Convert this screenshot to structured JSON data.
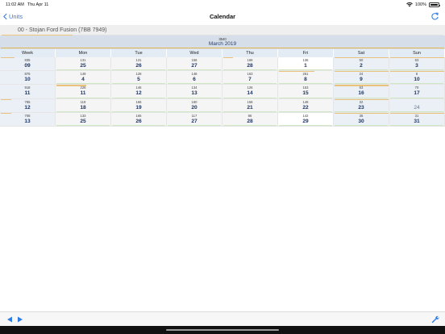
{
  "status_bar": {
    "time": "11:02 AM",
    "date": "Thu Apr 11",
    "battery": "100%",
    "battery_level": 1.0
  },
  "nav": {
    "back_label": "Units",
    "title": "Calendar"
  },
  "unit": {
    "name": "00 - Stojan Ford Fusion (7BB 7949)",
    "progress": 0.16
  },
  "month": {
    "count": "3540",
    "name": "March 2019",
    "progress": 1.0
  },
  "headers": [
    "Week",
    "Mon",
    "Tue",
    "Wed",
    "Thu",
    "Fri",
    "Sat",
    "Sun"
  ],
  "weeks": [
    {
      "count": "835",
      "week": "09",
      "bar": 0.25,
      "days": [
        {
          "count": "131",
          "date": "25",
          "bar": 0
        },
        {
          "count": "131",
          "date": "26",
          "bar": 0
        },
        {
          "count": "156",
          "date": "27",
          "bar": 0
        },
        {
          "count": "166",
          "date": "28",
          "bar": 0.18
        },
        {
          "count": "136",
          "date": "1",
          "bar": 0,
          "today": true
        },
        {
          "count": "50",
          "date": "2",
          "bar": 1.0,
          "weekend": true
        },
        {
          "count": "63",
          "date": "3",
          "bar": 1.0,
          "weekend": true
        }
      ]
    },
    {
      "count": "876",
      "week": "10",
      "bar": 0,
      "days": [
        {
          "count": "149",
          "date": "4",
          "bar": 0
        },
        {
          "count": "128",
          "date": "5",
          "bar": 0
        },
        {
          "count": "148",
          "date": "6",
          "bar": 0
        },
        {
          "count": "163",
          "date": "7",
          "bar": 0
        },
        {
          "count": "261",
          "date": "8",
          "bar": 0.65
        },
        {
          "count": "24",
          "date": "9",
          "bar": 1.0,
          "weekend": true
        },
        {
          "count": "6",
          "date": "10",
          "bar": 1.0,
          "weekend": true
        }
      ]
    },
    {
      "count": "918",
      "week": "11",
      "bar": 0,
      "days": [
        {
          "count": "226",
          "date": "11",
          "bar": 0.55
        },
        {
          "count": "146",
          "date": "12",
          "bar": 0
        },
        {
          "count": "134",
          "date": "13",
          "bar": 0
        },
        {
          "count": "126",
          "date": "14",
          "bar": 0
        },
        {
          "count": "153",
          "date": "15",
          "bar": 0
        },
        {
          "count": "63",
          "date": "16",
          "bar": 1.0,
          "weekend": true
        },
        {
          "count": "70",
          "date": "17",
          "bar": 0,
          "weekend": true
        }
      ]
    },
    {
      "count": "785",
      "week": "12",
      "bar": 0.2,
      "days": [
        {
          "count": "119",
          "date": "18",
          "bar": 0
        },
        {
          "count": "166",
          "date": "19",
          "bar": 0
        },
        {
          "count": "160",
          "date": "20",
          "bar": 0
        },
        {
          "count": "158",
          "date": "21",
          "bar": 0
        },
        {
          "count": "148",
          "date": "22",
          "bar": 0
        },
        {
          "count": "32",
          "date": "23",
          "bar": 1.0,
          "weekend": true
        },
        {
          "count": "",
          "date": "24",
          "bar": 0,
          "weekend": true,
          "dim": true
        }
      ]
    },
    {
      "count": "708",
      "week": "13",
      "bar": 0.2,
      "days": [
        {
          "count": "133",
          "date": "25",
          "bar": 0
        },
        {
          "count": "165",
          "date": "26",
          "bar": 0
        },
        {
          "count": "117",
          "date": "27",
          "bar": 0
        },
        {
          "count": "86",
          "date": "28",
          "bar": 0
        },
        {
          "count": "142",
          "date": "29",
          "bar": 0,
          "today": true
        },
        {
          "count": "35",
          "date": "30",
          "bar": 1.0,
          "weekend": true
        },
        {
          "count": "31",
          "date": "31",
          "bar": 1.0,
          "weekend": true
        }
      ]
    }
  ],
  "colors": {
    "accent": "#2f7ce3",
    "bar": "#e3b64d",
    "green": "#cfe6c3",
    "month_bg": "#d6deea"
  },
  "icons": {
    "back": "chevron-left-icon",
    "refresh": "refresh-icon",
    "prev": "triangle-left-icon",
    "next": "triangle-right-icon",
    "tools": "wrench-icon",
    "wifi": "wifi-icon",
    "battery": "battery-icon"
  }
}
